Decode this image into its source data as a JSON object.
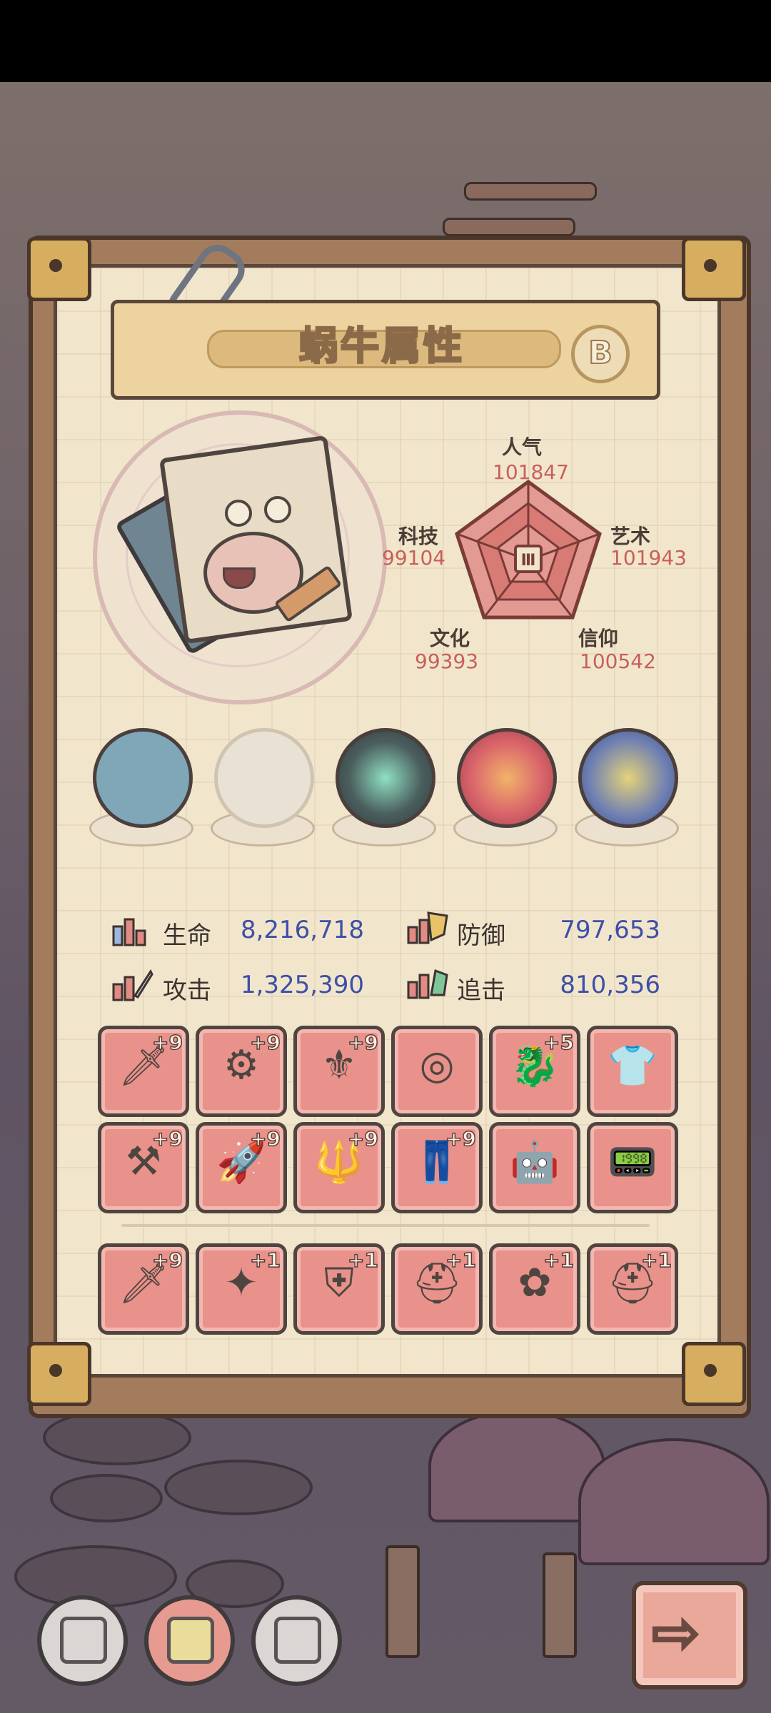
{
  "title": "蜗牛属性",
  "grade": "B",
  "radar": {
    "center_symbol": "Ⅲ",
    "stats": [
      {
        "key": "popularity",
        "label": "人气",
        "value": "101847"
      },
      {
        "key": "art",
        "label": "艺术",
        "value": "101943"
      },
      {
        "key": "faith",
        "label": "信仰",
        "value": "100542"
      },
      {
        "key": "culture",
        "label": "文化",
        "value": "99393"
      },
      {
        "key": "tech",
        "label": "科技",
        "value": "99104"
      }
    ]
  },
  "orbs": [
    {
      "name": "fish-monster-orb",
      "color": "#7fa7b8"
    },
    {
      "name": "empty-shell-orb",
      "color": "#e9e2d4"
    },
    {
      "name": "swirl-orb",
      "color": "#4b5f5e"
    },
    {
      "name": "red-spiral-orb",
      "color": "#d9646b"
    },
    {
      "name": "gem-cluster-orb",
      "color": "#6e7fb3"
    }
  ],
  "stats": [
    {
      "label": "生命",
      "value": "8,216,718",
      "icon": "health-pill-icon"
    },
    {
      "label": "防御",
      "value": "797,653",
      "icon": "defense-shield-icon"
    },
    {
      "label": "攻击",
      "value": "1,325,390",
      "icon": "attack-sword-icon"
    },
    {
      "label": "追击",
      "value": "810,356",
      "icon": "pursuit-boots-icon"
    }
  ],
  "equipment_rows": [
    [
      {
        "icon": "sword-icon",
        "glyph": "🗡",
        "level": "+9"
      },
      {
        "icon": "drill-weapon-icon",
        "glyph": "⚙",
        "level": "+9"
      },
      {
        "icon": "golden-scepter-icon",
        "glyph": "⚜",
        "level": "+9"
      },
      {
        "icon": "ring-icon",
        "glyph": "◎",
        "level": ""
      },
      {
        "icon": "dragon-statue-icon",
        "glyph": "🐉",
        "level": "+5"
      },
      {
        "icon": "shirt-armor-icon",
        "glyph": "👕",
        "level": ""
      }
    ],
    [
      {
        "icon": "mace-icon",
        "glyph": "⚒",
        "level": "+9"
      },
      {
        "icon": "rocket-sword-icon",
        "glyph": "🚀",
        "level": "+9"
      },
      {
        "icon": "trident-icon",
        "glyph": "🔱",
        "level": "+9"
      },
      {
        "icon": "pants-icon",
        "glyph": "👖",
        "level": "+9"
      },
      {
        "icon": "mech-suit-icon",
        "glyph": "🤖",
        "level": ""
      },
      {
        "icon": "device-icon",
        "glyph": "📟",
        "level": ""
      }
    ],
    [
      {
        "icon": "blade-icon",
        "glyph": "🗡",
        "level": "+9"
      },
      {
        "icon": "crystal-staff-icon",
        "glyph": "✦",
        "level": "+1"
      },
      {
        "icon": "red-armor-icon",
        "glyph": "⛨",
        "level": "+1"
      },
      {
        "icon": "winged-helm-icon",
        "glyph": "⛑",
        "level": "+1"
      },
      {
        "icon": "flower-medal-icon",
        "glyph": "✿",
        "level": "+1"
      },
      {
        "icon": "blue-helmet-icon",
        "glyph": "⛑",
        "level": "+1"
      }
    ]
  ],
  "bottom_nav": [
    {
      "name": "nav-button-gray-1",
      "color": "#d9d6d4"
    },
    {
      "name": "nav-button-red",
      "color": "#e79a8f"
    },
    {
      "name": "nav-button-gray-2",
      "color": "#d9d6d4"
    }
  ],
  "next_button": {
    "glyph": "⇨"
  }
}
